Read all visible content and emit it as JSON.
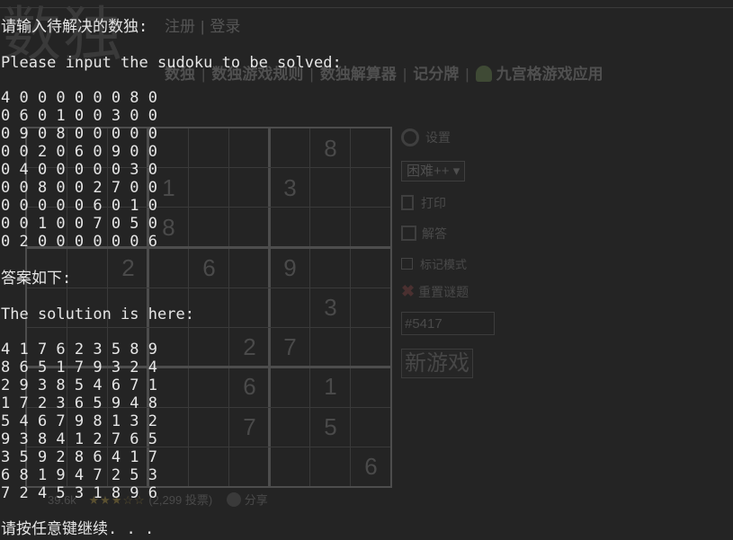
{
  "background_page": {
    "logo": "数独",
    "auth": [
      "注册",
      "|",
      "登录"
    ],
    "nav": [
      "数独",
      "数独游戏规则",
      "数独解算器",
      "记分牌",
      "九宫格游戏应用"
    ],
    "side": {
      "settings_label": "设置",
      "difficulty": "困难++",
      "print_label": "打印",
      "solve_label": "解答",
      "mark_mode_label": "标记模式",
      "reset_label": "重置谜题",
      "game_id": "#5417",
      "new_game_label": "新游戏"
    },
    "footer": {
      "likes": "39.6k",
      "votes": "(2,299 投票)",
      "share_label": "分享"
    },
    "board_digits": [
      {
        "r": 0,
        "c": 7,
        "v": "8"
      },
      {
        "r": 1,
        "c": 3,
        "v": "1"
      },
      {
        "r": 1,
        "c": 6,
        "v": "3"
      },
      {
        "r": 2,
        "c": 3,
        "v": "8"
      },
      {
        "r": 3,
        "c": 2,
        "v": "2"
      },
      {
        "r": 3,
        "c": 4,
        "v": "6"
      },
      {
        "r": 3,
        "c": 6,
        "v": "9"
      },
      {
        "r": 4,
        "c": 7,
        "v": "3"
      },
      {
        "r": 5,
        "c": 5,
        "v": "2"
      },
      {
        "r": 5,
        "c": 6,
        "v": "7"
      },
      {
        "r": 6,
        "c": 5,
        "v": "6"
      },
      {
        "r": 6,
        "c": 7,
        "v": "1"
      },
      {
        "r": 7,
        "c": 5,
        "v": "7"
      },
      {
        "r": 7,
        "c": 7,
        "v": "5"
      },
      {
        "r": 8,
        "c": 8,
        "v": "6"
      }
    ]
  },
  "console": {
    "prompt_cn": "请输入待解决的数独:",
    "prompt_en": "Please input the sudoku to be solved:",
    "puzzle_rows": [
      "4 0 0 0 0 0 0 8 0",
      "0 6 0 1 0 0 3 0 0",
      "0 9 0 8 0 0 0 0 0",
      "0 0 2 0 6 0 9 0 0",
      "0 4 0 0 0 0 0 3 0",
      "0 0 8 0 0 2 7 0 0",
      "0 0 0 0 0 6 0 1 0",
      "0 0 1 0 0 7 0 5 0",
      "0 2 0 0 0 0 0 0 6"
    ],
    "answer_cn": "答案如下:",
    "answer_en": "The solution is here:",
    "solution_rows": [
      "4 1 7 6 2 3 5 8 9",
      "8 6 5 1 7 9 3 2 4",
      "2 9 3 8 5 4 6 7 1",
      "1 7 2 3 6 5 9 4 8",
      "5 4 6 7 9 8 1 3 2",
      "9 3 8 4 1 2 7 6 5",
      "3 5 9 2 8 6 4 1 7",
      "6 8 1 9 4 7 2 5 3",
      "7 2 4 5 3 1 8 9 6"
    ],
    "continue_prompt": "请按任意键继续. . ."
  }
}
